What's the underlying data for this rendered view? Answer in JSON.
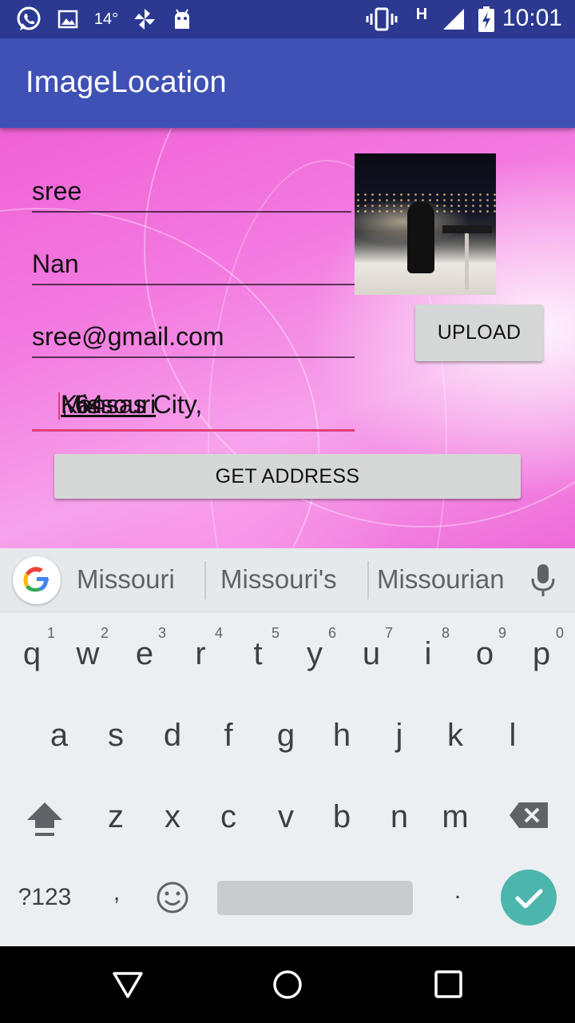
{
  "status_bar": {
    "temperature": "14°",
    "network_type": "H",
    "time": "10:01",
    "icons": [
      "whatsapp-icon",
      "image-icon",
      "pinwheel-icon",
      "android-icon",
      "vibrate-icon",
      "signal-icon",
      "battery-charging-icon"
    ]
  },
  "app_bar": {
    "title": "ImageLocation"
  },
  "form": {
    "first_name": "sree",
    "last_name": "Nan",
    "email": "sree@gmail.com",
    "address_prefix": "Kansas City, ",
    "address_composing": "Missouri",
    "address_suffix": ", 64",
    "upload_label": "UPLOAD",
    "get_address_label": "GET ADDRESS"
  },
  "keyboard": {
    "suggestions": [
      "Missouri",
      "Missouri's",
      "Missourian"
    ],
    "row1": [
      "q",
      "w",
      "e",
      "r",
      "t",
      "y",
      "u",
      "i",
      "o",
      "p"
    ],
    "row1_hints": [
      "1",
      "2",
      "3",
      "4",
      "5",
      "6",
      "7",
      "8",
      "9",
      "0"
    ],
    "row2": [
      "a",
      "s",
      "d",
      "f",
      "g",
      "h",
      "j",
      "k",
      "l"
    ],
    "row3": [
      "z",
      "x",
      "c",
      "v",
      "b",
      "n",
      "m"
    ],
    "symbols_label": "?123",
    "comma": ",",
    "period": ".",
    "accent_color": "#4db6ac"
  },
  "colors": {
    "status_bar": "#2b3990",
    "app_bar": "#3f51b5",
    "focus_underline": "#e0407a"
  }
}
